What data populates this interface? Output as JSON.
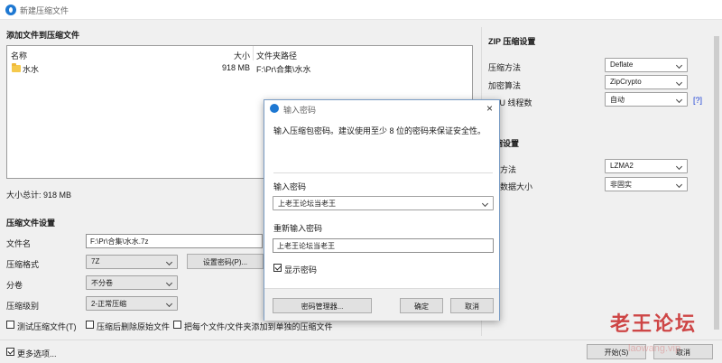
{
  "window": {
    "title": "新建压缩文件"
  },
  "files": {
    "heading": "添加文件到压缩文件",
    "columns": {
      "name": "名称",
      "size": "大小",
      "path": "文件夹路径"
    },
    "rows": [
      {
        "name": "水水",
        "size": "918 MB",
        "path": "F:\\Pr\\合集\\水水"
      }
    ],
    "total": "大小总计: 918 MB"
  },
  "settings": {
    "heading": "压缩文件设置",
    "filename_label": "文件名",
    "filename_value": "F:\\Pr\\合集\\水水.7z",
    "format_label": "压缩格式",
    "format_value": "7Z",
    "set_password_button": "设置密码(P)...",
    "volume_label": "分卷",
    "volume_value": "不分卷",
    "level_label": "压缩级别",
    "level_value": "2-正常压缩",
    "test_label": "测试压缩文件(T)",
    "delete_label": "压缩后删除原始文件",
    "each_label": "把每个文件/文件夹添加到单独的压缩文件",
    "more_options": "更多选项..."
  },
  "zip_settings": {
    "heading": "ZIP 压缩设置",
    "method_label": "压缩方法",
    "method_value": "Deflate",
    "encrypt_label": "加密算法",
    "encrypt_value": "ZipCrypto",
    "cpu_label": "CPU 线程数",
    "cpu_value": "自动",
    "help": "[?]"
  },
  "z7_settings": {
    "heading": "缩设置",
    "method_label": "方法",
    "method_value": "LZMA2",
    "solid_label": "数据大小",
    "solid_value": "非固实"
  },
  "buttons": {
    "start": "开始(S)",
    "cancel": "取消"
  },
  "dialog": {
    "title": "输入密码",
    "desc": "输入压缩包密码。建议使用至少 8 位的密码来保证安全性。",
    "enter_label": "输入密码",
    "enter_value": "上老王论坛当老王",
    "reenter_label": "重新输入密码",
    "reenter_value": "上老王论坛当老王",
    "show_label": "显示密码",
    "show_checked": true,
    "manager_button": "密码管理器...",
    "ok_button": "确定",
    "cancel_button": "取消"
  },
  "watermark": {
    "main": "老王论坛",
    "sub": "laowang.vip"
  },
  "colors": {
    "accent": "#1e78d2",
    "link": "#1a3fd6",
    "watermark": "#c82828"
  }
}
